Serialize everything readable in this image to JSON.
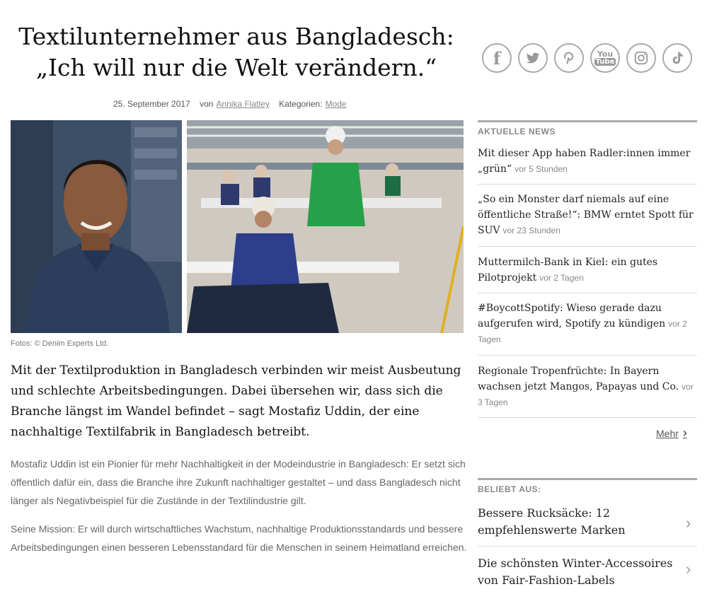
{
  "article": {
    "title": "Textilunternehmer aus Bangladesch: „Ich will nur die Welt verändern.“",
    "date": "25. September 2017",
    "by_label": "von",
    "author": "Annika Flatley",
    "categories_label": "Kategorien:",
    "category": "Mode",
    "photo_caption": "Fotos: © Denim Experts Ltd.",
    "lead": "Mit der Textilproduktion in Bangladesch verbinden wir meist Ausbeutung und schlechte Arbeitsbedingungen. Dabei übersehen wir, dass sich die Branche längst im Wandel befindet – sagt Mostafiz Uddin, der eine nachhaltige Textilfabrik in Bangladesch betreibt.",
    "paragraph1": "Mostafiz Uddin ist ein Pionier für mehr Nachhaltigkeit in der Modeindustrie in Bangladesch: Er setzt sich öffentlich dafür ein, dass die Branche ihre Zukunft nachhaltiger gestaltet – und dass Bangladesch nicht länger als Negativbeispiel für die Zustände in der Textilindustrie gilt.",
    "paragraph2": "Seine Mission: Er will durch wirtschaftliches Wachstum, nachhaltige Produktionsstandards und bessere Arbeitsbedingungen einen besseren Lebensstandard für die Menschen in seinem Heimatland erreichen."
  },
  "social": {
    "icons": [
      "facebook-icon",
      "twitter-icon",
      "pinterest-icon",
      "youtube-icon",
      "instagram-icon",
      "tiktok-icon"
    ],
    "glyphs": {
      "facebook": "f",
      "youtube_top": "You",
      "youtube_bottom": "Tube"
    }
  },
  "sidebar": {
    "news_heading": "AKTUELLE NEWS",
    "news": [
      {
        "title": "Mit dieser App haben Radler:innen immer „grün“",
        "time": "vor 5 Stunden"
      },
      {
        "title": "„So ein Monster darf niemals auf eine öffentliche Straße!“: BMW erntet Spott für SUV",
        "time": "vor 23 Stunden"
      },
      {
        "title": "Muttermilch-Bank in Kiel: ein gutes Pilotprojekt",
        "time": "vor 2 Tagen"
      },
      {
        "title": "#BoycottSpotify: Wieso gerade dazu aufgerufen wird, Spotify zu kündigen",
        "time": "vor 2 Tagen"
      },
      {
        "title": "Regionale Tropenfrüchte: In Bayern wachsen jetzt Mangos, Papayas und Co.",
        "time": "vor 3 Tagen"
      }
    ],
    "more_label": "Mehr",
    "popular_heading": "BELIEBT AUS:",
    "popular": [
      {
        "title": "Bessere Rucksäcke: 12 empfehlenswerte Marken"
      },
      {
        "title": "Die schönsten Winter-Accessoires von Fair-Fashion-Labels"
      }
    ]
  },
  "colors": {
    "accent_gray": "#aaaaaa",
    "link_gray": "#888888"
  }
}
